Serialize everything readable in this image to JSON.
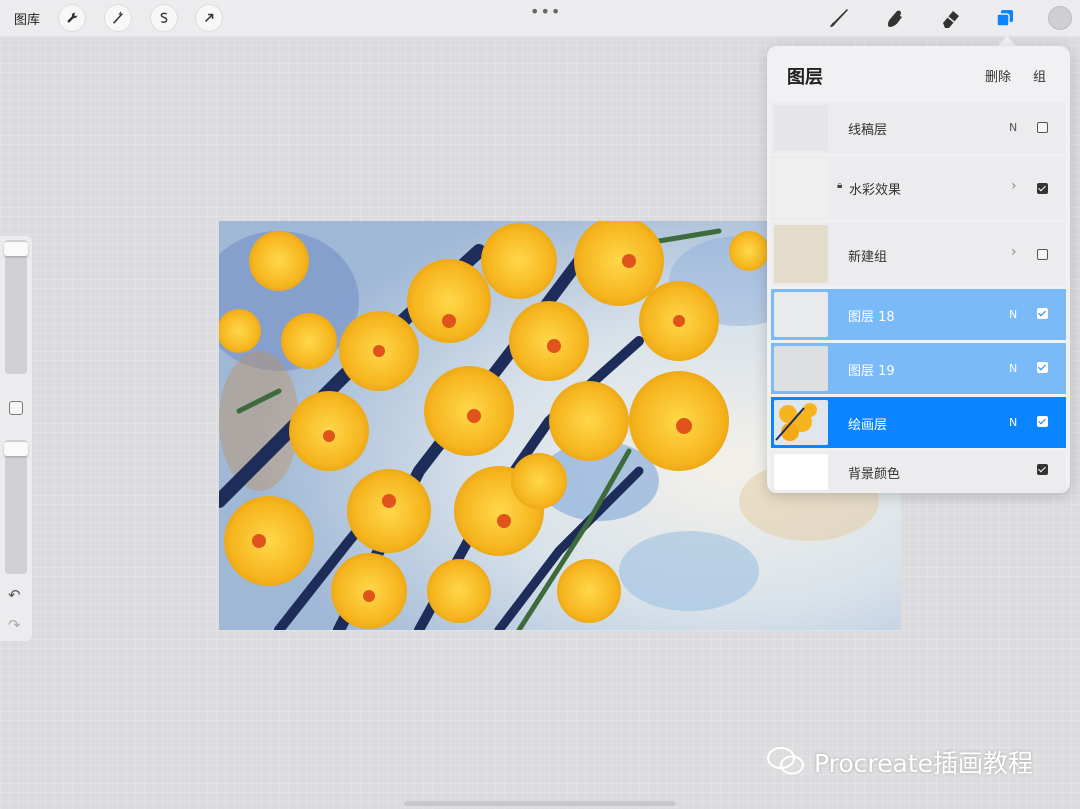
{
  "topbar": {
    "gallery_label": "图库",
    "tools_left": [
      "wrench-icon",
      "magic-wand-icon",
      "selection-s-icon",
      "transform-arrow-icon"
    ],
    "dots": "•••",
    "tools_right": [
      "brush-icon",
      "smudge-icon",
      "eraser-icon",
      "layers-icon"
    ]
  },
  "sidebar": {
    "undo": "↶",
    "redo": "↷"
  },
  "layers_panel": {
    "title": "图层",
    "delete_label": "删除",
    "group_label": "组",
    "layers": [
      {
        "name": "线稿层",
        "mode": "N",
        "visible": false
      },
      {
        "name": "水彩效果",
        "mode": "",
        "visible": true,
        "locked": true,
        "group": true
      },
      {
        "name": "新建组",
        "mode": "",
        "visible": false,
        "group": true
      },
      {
        "name": "图层 18",
        "mode": "N",
        "visible": true,
        "selected": true
      },
      {
        "name": "图层 19",
        "mode": "N",
        "visible": true,
        "selected": true
      },
      {
        "name": "绘画层",
        "mode": "N",
        "visible": true,
        "active": true
      },
      {
        "name": "背景颜色",
        "mode": "",
        "visible": true
      }
    ]
  },
  "watermark": {
    "text": "Procreate插画教程"
  },
  "colors": {
    "accent": "#0a84ff",
    "selected": "#7abaf9"
  }
}
